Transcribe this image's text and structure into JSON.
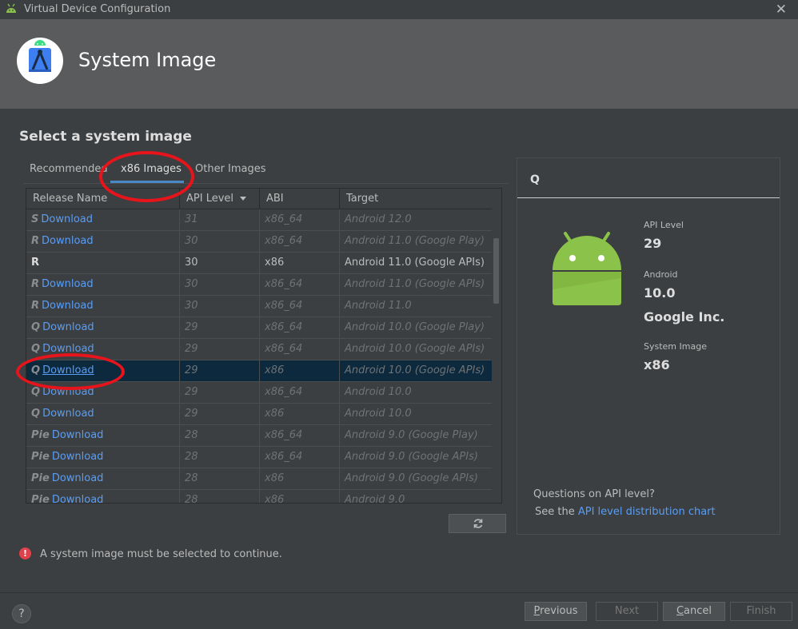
{
  "window": {
    "title": "Virtual Device Configuration"
  },
  "header": {
    "title": "System Image"
  },
  "section_title": "Select a system image",
  "tabs": [
    {
      "label": "Recommended",
      "active": false
    },
    {
      "label": "x86 Images",
      "active": true
    },
    {
      "label": "Other Images",
      "active": false
    }
  ],
  "table": {
    "columns": [
      "Release Name",
      "API Level",
      "ABI",
      "Target"
    ],
    "sort_column": "API Level",
    "rows": [
      {
        "release": "S",
        "link": "Download",
        "api": "31",
        "abi": "x86_64",
        "target": "Android 12.0",
        "installed": false,
        "selected": false
      },
      {
        "release": "R",
        "link": "Download",
        "api": "30",
        "abi": "x86_64",
        "target": "Android 11.0 (Google Play)",
        "installed": false,
        "selected": false
      },
      {
        "release": "R",
        "link": "",
        "api": "30",
        "abi": "x86",
        "target": "Android 11.0 (Google APIs)",
        "installed": true,
        "selected": false
      },
      {
        "release": "R",
        "link": "Download",
        "api": "30",
        "abi": "x86_64",
        "target": "Android 11.0 (Google APIs)",
        "installed": false,
        "selected": false
      },
      {
        "release": "R",
        "link": "Download",
        "api": "30",
        "abi": "x86_64",
        "target": "Android 11.0",
        "installed": false,
        "selected": false
      },
      {
        "release": "Q",
        "link": "Download",
        "api": "29",
        "abi": "x86_64",
        "target": "Android 10.0 (Google Play)",
        "installed": false,
        "selected": false
      },
      {
        "release": "Q",
        "link": "Download",
        "api": "29",
        "abi": "x86_64",
        "target": "Android 10.0 (Google APIs)",
        "installed": false,
        "selected": false
      },
      {
        "release": "Q",
        "link": "Download",
        "api": "29",
        "abi": "x86",
        "target": "Android 10.0 (Google APIs)",
        "installed": false,
        "selected": true
      },
      {
        "release": "Q",
        "link": "Download",
        "api": "29",
        "abi": "x86_64",
        "target": "Android 10.0",
        "installed": false,
        "selected": false
      },
      {
        "release": "Q",
        "link": "Download",
        "api": "29",
        "abi": "x86",
        "target": "Android 10.0",
        "installed": false,
        "selected": false
      },
      {
        "release": "Pie",
        "link": "Download",
        "api": "28",
        "abi": "x86_64",
        "target": "Android 9.0 (Google Play)",
        "installed": false,
        "selected": false
      },
      {
        "release": "Pie",
        "link": "Download",
        "api": "28",
        "abi": "x86_64",
        "target": "Android 9.0 (Google APIs)",
        "installed": false,
        "selected": false
      },
      {
        "release": "Pie",
        "link": "Download",
        "api": "28",
        "abi": "x86",
        "target": "Android 9.0 (Google APIs)",
        "installed": false,
        "selected": false
      },
      {
        "release": "Pie",
        "link": "Download",
        "api": "28",
        "abi": "x86",
        "target": "Android 9.0",
        "installed": false,
        "selected": false
      }
    ]
  },
  "detail": {
    "name": "Q",
    "api_level_label": "API Level",
    "api_level": "29",
    "android_label": "Android",
    "android_version": "10.0",
    "vendor": "Google Inc.",
    "system_image_label": "System Image",
    "system_image": "x86",
    "question": "Questions on API level?",
    "see_prefix": "See the ",
    "chart_link": "API level distribution chart"
  },
  "error": {
    "text": "A system image must be selected to continue."
  },
  "footer": {
    "help": "?",
    "previous_u": "P",
    "previous_rest": "revious",
    "next": "Next",
    "cancel_u": "C",
    "cancel_rest": "ancel",
    "finish": "Finish"
  },
  "colors": {
    "accent": "#4a88c7",
    "link": "#589df6",
    "selection": "#0d293e",
    "annotation": "#e8141c",
    "android_green": "#8bc34a",
    "error": "#e0424b"
  },
  "icons": {
    "window": "android-head-icon",
    "header": "android-studio-icon",
    "refresh": "refresh-icon",
    "error": "error-icon",
    "help": "help-icon"
  }
}
